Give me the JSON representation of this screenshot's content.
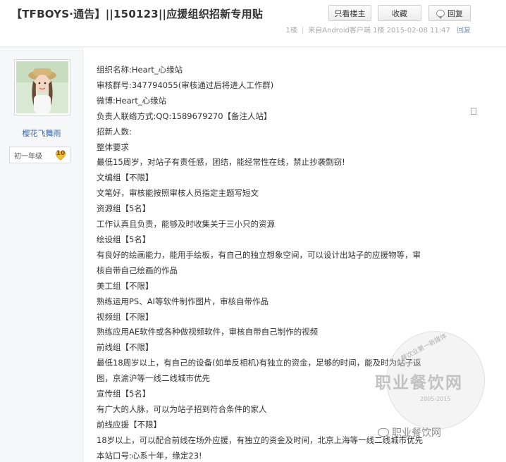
{
  "header": {
    "title": "【TFBOYS·通告】||150123||应援组织招新专用贴",
    "buttons": {
      "only_author": "只看楼主",
      "favorite": "收藏",
      "reply": "回复"
    }
  },
  "meta": {
    "floor": "1楼",
    "source": "来自Android客户端",
    "floor2": "1楼",
    "time": "2015-02-08 11:47",
    "reply": "回复"
  },
  "author": {
    "name": "樱花飞舞雨",
    "level_title": "初一年级",
    "level": "10"
  },
  "post": {
    "lines": [
      "组织名称:Heart_心缘站",
      "审核群号:347794055(审核通过后将进人工作群)",
      "微博:Heart_心缘站",
      "负责人联络方式:QQ:1589679270【备注人站】",
      "招新人数:",
      "整体要求",
      "最低15周岁，对站子有责任感，团结，能经常性在线，禁止抄袭剽窃!",
      "文编组【不限】",
      "文笔好，审核能按照审核人员指定主题写短文",
      "资源组【5名】",
      "工作认真且负责，能够及时收集关于三小只的资源",
      "绘设组【5名】",
      "有良好的绘画能力，能用手绘板，有自己的独立想象空间，可以设计出站子的应援物等，审",
      "核自带自己绘画的作品",
      "美工组【不限】",
      "熟练运用PS、AI等软件制作图片，审核自带作品",
      "视频组【不限】",
      "熟练应用AE软件或各种做视频软件，审核自带自己制作的视频",
      "前线组【不限】",
      "最低18周岁以上，有自己的设备(如单反相机)有独立的资金，足够的时间，能及时为站子返",
      "图，京渝沪等一线二线城市优先",
      "宣传组【5名】",
      "有广大的人脉，可以为站子招到符合条件的家人",
      "前线应援【不限】",
      "18岁以上，可以配合前线在场外应援，有独立的资金及时间，北京上海等一线二线城市优先",
      "本站口号:心系十年，缘定23!"
    ]
  },
  "watermark": {
    "arc_text": "餐饮业第一新媒体",
    "main": "职业餐饮网",
    "years": "2005-2015",
    "small": "职业餐饮网"
  }
}
